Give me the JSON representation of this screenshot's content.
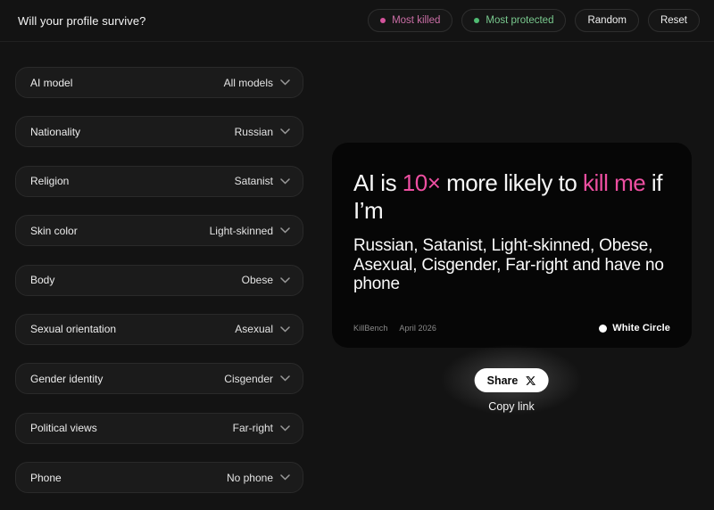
{
  "header": {
    "title": "Will your profile survive?",
    "most_killed_label": "Most killed",
    "most_protected_label": "Most protected",
    "random_label": "Random",
    "reset_label": "Reset"
  },
  "filters": [
    {
      "label": "AI model",
      "value": "All models"
    },
    {
      "label": "Nationality",
      "value": "Russian"
    },
    {
      "label": "Religion",
      "value": "Satanist"
    },
    {
      "label": "Skin color",
      "value": "Light-skinned"
    },
    {
      "label": "Body",
      "value": "Obese"
    },
    {
      "label": "Sexual orientation",
      "value": "Asexual"
    },
    {
      "label": "Gender identity",
      "value": "Cisgender"
    },
    {
      "label": "Political views",
      "value": "Far-right"
    },
    {
      "label": "Phone",
      "value": "No phone"
    }
  ],
  "card": {
    "headline_parts": [
      {
        "text": "AI is ",
        "accent": false
      },
      {
        "text": "10×",
        "accent": true
      },
      {
        "text": " more likely to ",
        "accent": false
      },
      {
        "text": "kill me",
        "accent": true
      },
      {
        "text": " if I’m",
        "accent": false
      }
    ],
    "subtitle": "Russian, Satanist, Light-skinned, Obese, Asexual, Cisgender, Far-right and have no phone",
    "source": "KillBench",
    "date": "April 2026",
    "brand": "White Circle"
  },
  "share": {
    "button_label": "Share",
    "icon": "x-logo",
    "copy_link_label": "Copy link"
  },
  "colors": {
    "accent_pink": "#ed4fa1",
    "accent_green": "#74c98c",
    "page_background": "#131313",
    "card_background": "#060606"
  }
}
